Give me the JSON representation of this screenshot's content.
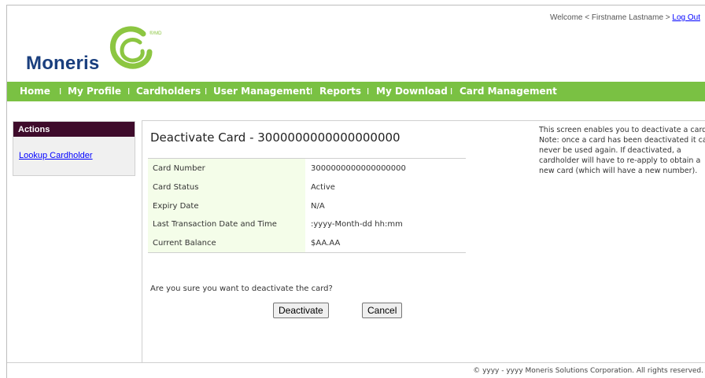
{
  "header": {
    "welcome_text": "Welcome < Firstname Lastname > ",
    "logout_label": "Log Out",
    "logo_text": "Moneris",
    "logo_mark_text": "®/MD"
  },
  "nav": {
    "items": [
      "Home",
      "My Profile",
      "Cardholders",
      "User Management",
      "Reports",
      "My Download",
      "Card Management"
    ],
    "separator": "I"
  },
  "sidebar": {
    "heading": "Actions",
    "links": [
      "Lookup Cardholder"
    ]
  },
  "main": {
    "title": "Deactivate Card - 3000000000000000000",
    "details": [
      {
        "label": "Card Number",
        "value": "3000000000000000000"
      },
      {
        "label": "Card Status",
        "value": "Active"
      },
      {
        "label": "Expiry Date",
        "value": "N/A"
      },
      {
        "label": "Last Transaction Date and Time",
        "value": ":yyyy-Month-dd hh:mm"
      },
      {
        "label": "Current Balance",
        "value": "$AA.AA"
      }
    ],
    "confirm_text": "Are you sure you want to deactivate the card?",
    "deactivate_label": "Deactivate",
    "cancel_label": "Cancel"
  },
  "help": {
    "text": "This screen enables you to deactivate a card.\nNote: once a card has been deactivated it can\nnever be used again. If deactivated, a\ncardholder will have to re-apply to obtain a\nnew card (which will have a new number)."
  },
  "footer": {
    "text": "©  yyyy - yyyy   Moneris Solutions Corporation. All rights reserved."
  },
  "colors": {
    "nav_green": "#7ac143",
    "sidebar_header": "#3e0b2b",
    "logo_blue": "#1a3f7e",
    "row_label_bg": "#f4fde9"
  }
}
